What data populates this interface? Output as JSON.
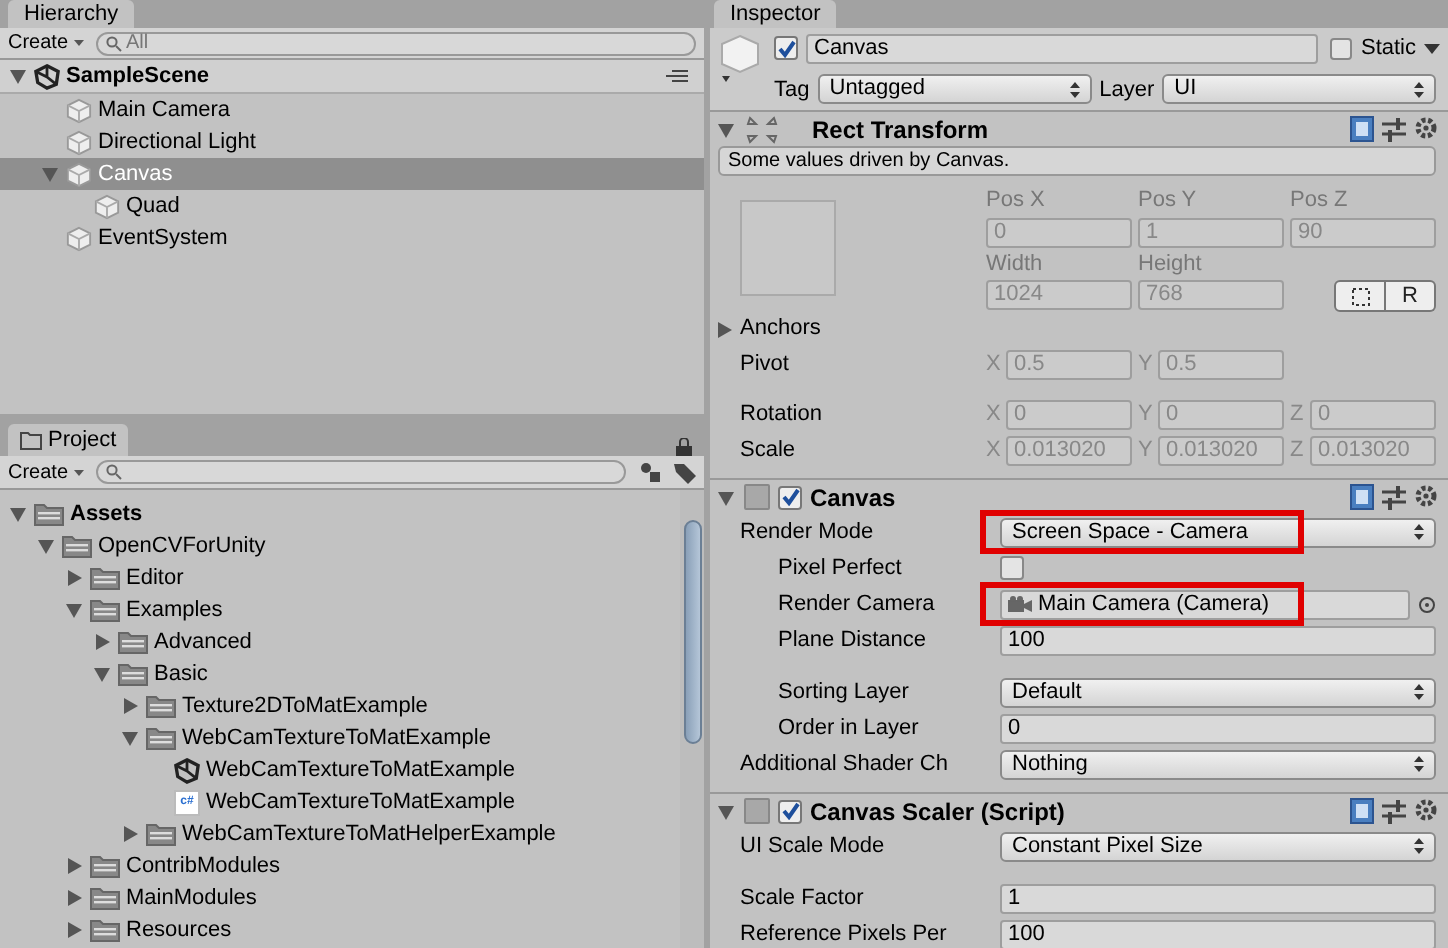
{
  "hierarchy": {
    "tab": "Hierarchy",
    "create": "Create",
    "search_placeholder": "All",
    "scene": "SampleScene",
    "items": [
      {
        "label": "Main Camera",
        "selected": false
      },
      {
        "label": "Directional Light",
        "selected": false
      },
      {
        "label": "Canvas",
        "selected": true,
        "expanded": true,
        "children": [
          {
            "label": "Quad",
            "selected": false
          }
        ]
      },
      {
        "label": "EventSystem",
        "selected": false
      }
    ]
  },
  "project": {
    "tab": "Project",
    "create": "Create",
    "tree": [
      {
        "label": "Assets",
        "kind": "folder",
        "bold": true,
        "expanded": true,
        "children": [
          {
            "label": "OpenCVForUnity",
            "kind": "folder",
            "expanded": true,
            "children": [
              {
                "label": "Editor",
                "kind": "folder",
                "expanded": false
              },
              {
                "label": "Examples",
                "kind": "folder",
                "expanded": true,
                "children": [
                  {
                    "label": "Advanced",
                    "kind": "folder",
                    "expanded": false
                  },
                  {
                    "label": "Basic",
                    "kind": "folder",
                    "expanded": true,
                    "children": [
                      {
                        "label": "Texture2DToMatExample",
                        "kind": "folder",
                        "expanded": false
                      },
                      {
                        "label": "WebCamTextureToMatExample",
                        "kind": "folder",
                        "expanded": true,
                        "children": [
                          {
                            "label": "WebCamTextureToMatExample",
                            "kind": "scene"
                          },
                          {
                            "label": "WebCamTextureToMatExample",
                            "kind": "script",
                            "badge": "c#"
                          }
                        ]
                      },
                      {
                        "label": "WebCamTextureToMatHelperExample",
                        "kind": "folder",
                        "expanded": false
                      }
                    ]
                  }
                ]
              },
              {
                "label": "ContribModules",
                "kind": "folder",
                "expanded": false
              },
              {
                "label": "MainModules",
                "kind": "folder",
                "expanded": false
              },
              {
                "label": "Resources",
                "kind": "folder",
                "expanded": false
              }
            ]
          }
        ]
      }
    ]
  },
  "inspector": {
    "tab": "Inspector",
    "object": {
      "active": true,
      "name": "Canvas",
      "static": false,
      "static_label": "Static",
      "tag_label": "Tag",
      "tag": "Untagged",
      "layer_label": "Layer",
      "layer": "UI"
    },
    "components": [
      {
        "kind": "rect",
        "title": "Rect Transform",
        "note": "Some values driven by Canvas.",
        "labels1": [
          "Pos X",
          "Pos Y",
          "Pos Z"
        ],
        "values1": [
          "0",
          "1",
          "90"
        ],
        "labels2": [
          "Width",
          "Height"
        ],
        "values2": [
          "1024",
          "768"
        ],
        "reset": "R",
        "anchors": "Anchors",
        "rows": [
          {
            "label": "Pivot",
            "axes": [
              {
                "axis": "X",
                "value": "0.5"
              },
              {
                "axis": "Y",
                "value": "0.5"
              }
            ]
          },
          {
            "label": "Rotation",
            "axes": [
              {
                "axis": "X",
                "value": "0"
              },
              {
                "axis": "Y",
                "value": "0"
              },
              {
                "axis": "Z",
                "value": "0"
              }
            ]
          },
          {
            "label": "Scale",
            "axes": [
              {
                "axis": "X",
                "value": "0.013020"
              },
              {
                "axis": "Y",
                "value": "0.013020"
              },
              {
                "axis": "Z",
                "value": "0.013020"
              }
            ]
          }
        ]
      },
      {
        "kind": "component",
        "title": "Canvas",
        "enabled": true,
        "rows": [
          {
            "kind": "dropdown",
            "label": "Render Mode",
            "value": "Screen Space - Camera",
            "highlighted": true
          },
          {
            "kind": "checkbox",
            "label": "Pixel Perfect",
            "checked": false,
            "indent": true
          },
          {
            "kind": "object",
            "label": "Render Camera",
            "value": "Main Camera (Camera)",
            "highlighted": true,
            "indent": true
          },
          {
            "kind": "field",
            "label": "Plane Distance",
            "value": "100",
            "indent": true
          },
          {
            "kind": "spacer"
          },
          {
            "kind": "dropdown",
            "label": "Sorting Layer",
            "value": "Default",
            "indent": true
          },
          {
            "kind": "field",
            "label": "Order in Layer",
            "value": "0",
            "indent": true
          },
          {
            "kind": "dropdown",
            "label": "Additional Shader Ch",
            "value": "Nothing"
          }
        ]
      },
      {
        "kind": "component",
        "title": "Canvas Scaler (Script)",
        "enabled": true,
        "rows": [
          {
            "kind": "dropdown",
            "label": "UI Scale Mode",
            "value": "Constant Pixel Size"
          },
          {
            "kind": "spacer"
          },
          {
            "kind": "field",
            "label": "Scale Factor",
            "value": "1"
          },
          {
            "kind": "field",
            "label": "Reference Pixels Per",
            "value": "100"
          }
        ]
      }
    ]
  }
}
